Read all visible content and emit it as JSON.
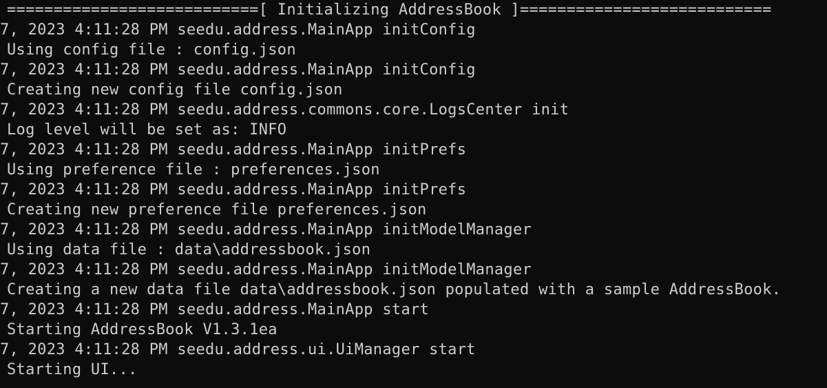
{
  "terminal": {
    "header": "===========================[ Initializing AddressBook ]===========================",
    "entries": [
      {
        "header": "7, 2023 4:11:28 PM seedu.address.MainApp initConfig",
        "message": "Using config file : config.json"
      },
      {
        "header": "7, 2023 4:11:28 PM seedu.address.MainApp initConfig",
        "message": "Creating new config file config.json"
      },
      {
        "header": "7, 2023 4:11:28 PM seedu.address.commons.core.LogsCenter init",
        "message": "Log level will be set as: INFO"
      },
      {
        "header": "7, 2023 4:11:28 PM seedu.address.MainApp initPrefs",
        "message": "Using preference file : preferences.json"
      },
      {
        "header": "7, 2023 4:11:28 PM seedu.address.MainApp initPrefs",
        "message": "Creating new preference file preferences.json"
      },
      {
        "header": "7, 2023 4:11:28 PM seedu.address.MainApp initModelManager",
        "message": "Using data file : data\\addressbook.json"
      },
      {
        "header": "7, 2023 4:11:28 PM seedu.address.MainApp initModelManager",
        "message": "Creating a new data file data\\addressbook.json populated with a sample AddressBook."
      },
      {
        "header": "7, 2023 4:11:28 PM seedu.address.MainApp start",
        "message": "Starting AddressBook V1.3.1ea"
      },
      {
        "header": "7, 2023 4:11:28 PM seedu.address.ui.UiManager start",
        "message": "Starting UI..."
      }
    ]
  },
  "colors": {
    "background": "#0c0c0c",
    "text": "#cccccc"
  }
}
